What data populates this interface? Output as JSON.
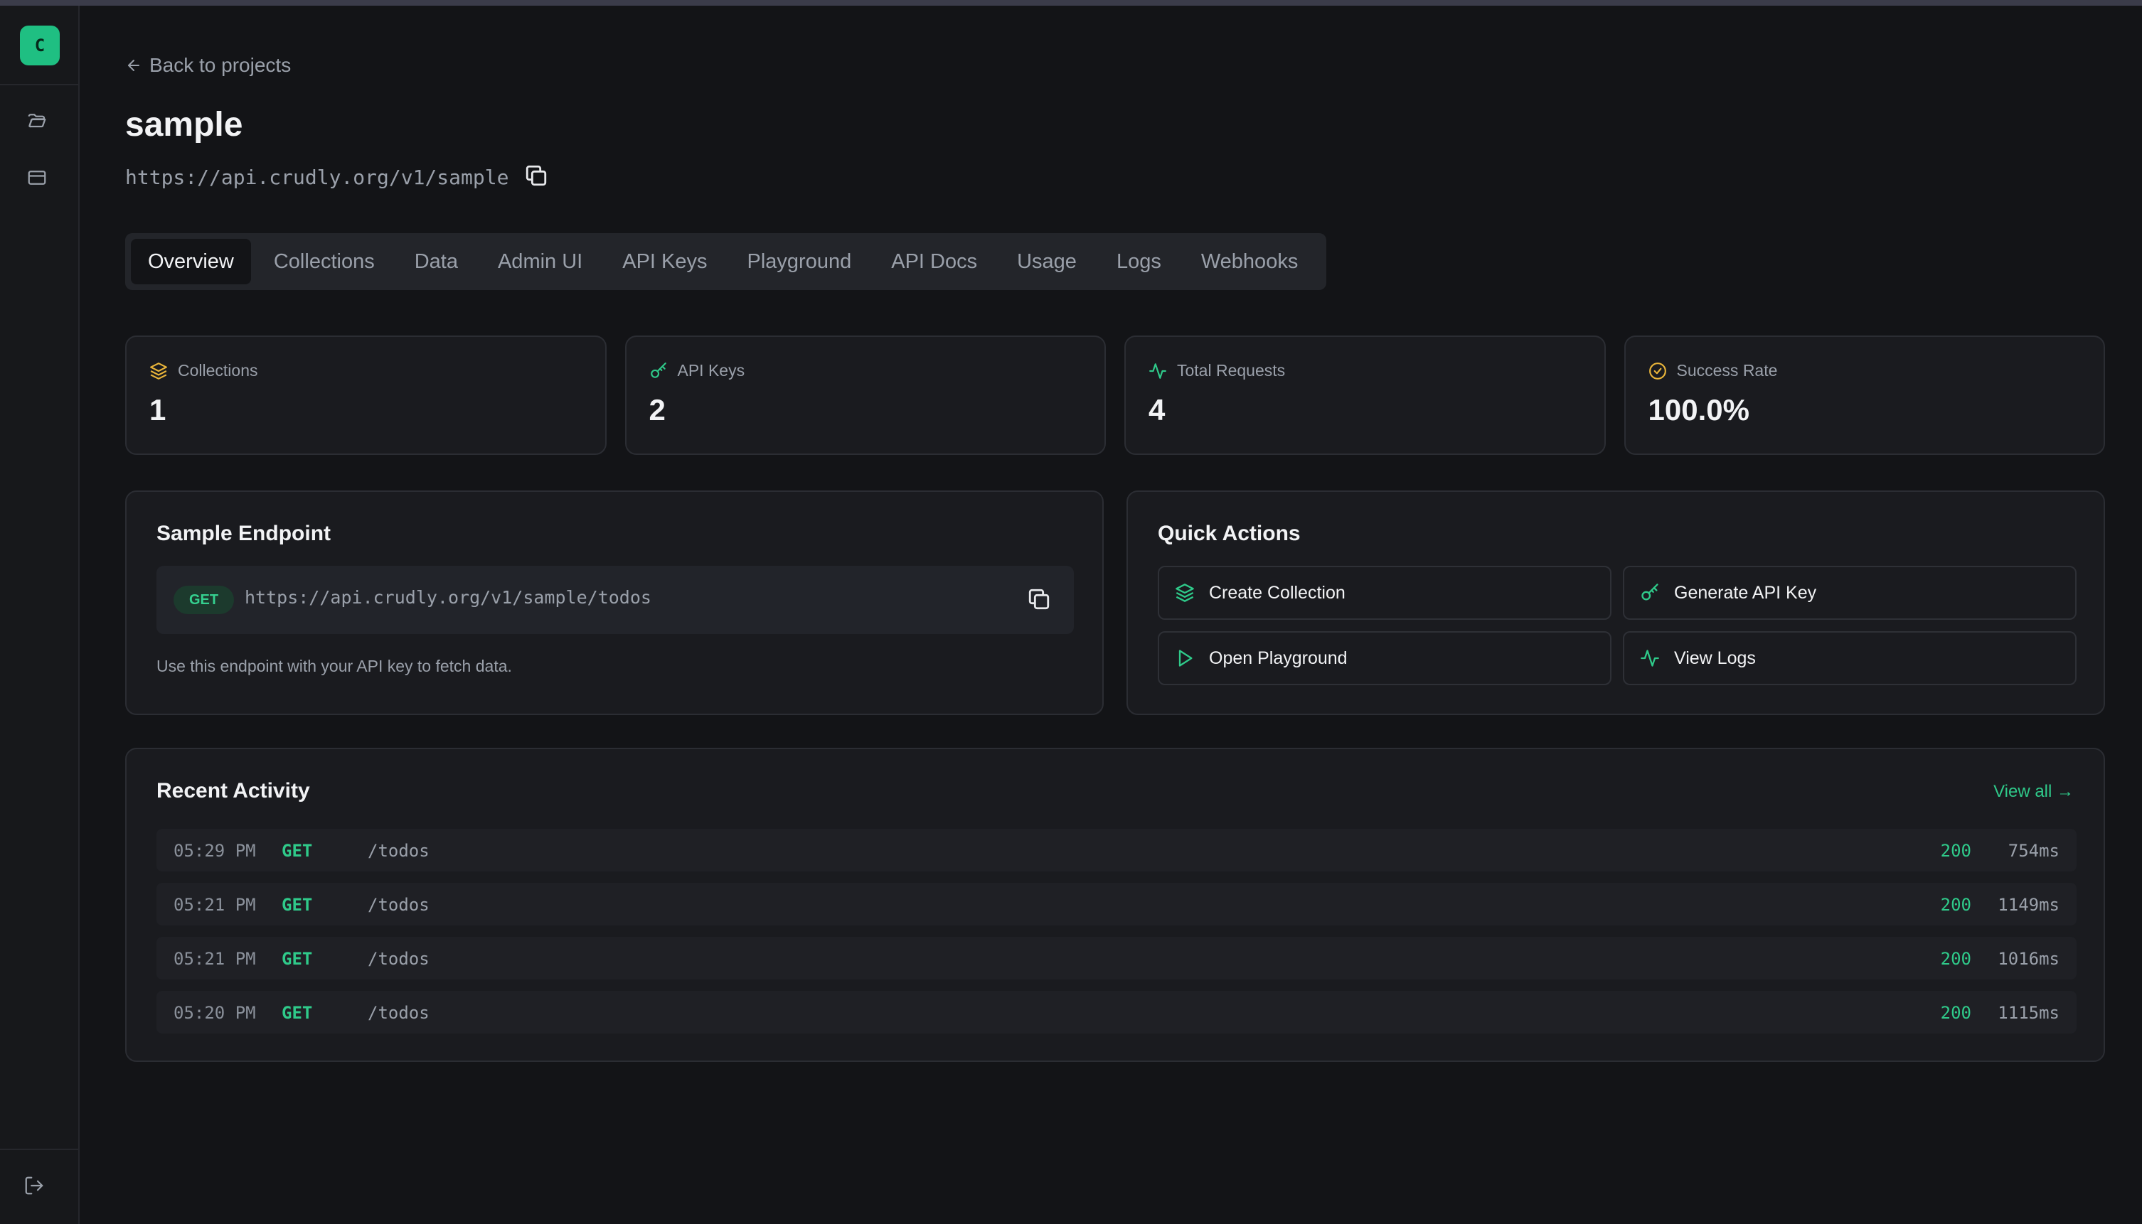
{
  "app": {
    "logo_letter": "C"
  },
  "header": {
    "back_label": "Back to projects",
    "project_name": "sample",
    "base_url": "https://api.crudly.org/v1/sample"
  },
  "tabs": [
    {
      "label": "Overview",
      "active": true
    },
    {
      "label": "Collections"
    },
    {
      "label": "Data"
    },
    {
      "label": "Admin UI"
    },
    {
      "label": "API Keys"
    },
    {
      "label": "Playground"
    },
    {
      "label": "API Docs"
    },
    {
      "label": "Usage"
    },
    {
      "label": "Logs"
    },
    {
      "label": "Webhooks"
    }
  ],
  "stats": [
    {
      "label": "Collections",
      "value": "1",
      "icon": "layers-icon"
    },
    {
      "label": "API Keys",
      "value": "2",
      "icon": "key-icon"
    },
    {
      "label": "Total Requests",
      "value": "4",
      "icon": "activity-icon"
    },
    {
      "label": "Success Rate",
      "value": "100.0%",
      "icon": "check-circle-icon"
    }
  ],
  "sample_endpoint": {
    "title": "Sample Endpoint",
    "method": "GET",
    "url": "https://api.crudly.org/v1/sample/todos",
    "note": "Use this endpoint with your API key to fetch data."
  },
  "quick_actions": {
    "title": "Quick Actions",
    "items": [
      {
        "label": "Create Collection",
        "icon": "layers-icon"
      },
      {
        "label": "Generate API Key",
        "icon": "key-icon"
      },
      {
        "label": "Open Playground",
        "icon": "play-icon"
      },
      {
        "label": "View Logs",
        "icon": "activity-icon"
      }
    ]
  },
  "recent_activity": {
    "title": "Recent Activity",
    "view_all": "View all →",
    "rows": [
      {
        "time": "05:29 PM",
        "method": "GET",
        "path": "/todos",
        "status": "200",
        "duration": "754ms"
      },
      {
        "time": "05:21 PM",
        "method": "GET",
        "path": "/todos",
        "status": "200",
        "duration": "1149ms"
      },
      {
        "time": "05:21 PM",
        "method": "GET",
        "path": "/todos",
        "status": "200",
        "duration": "1016ms"
      },
      {
        "time": "05:20 PM",
        "method": "GET",
        "path": "/todos",
        "status": "200",
        "duration": "1115ms"
      }
    ]
  },
  "colors": {
    "accent": "#2fca8a",
    "warning": "#e8b43a",
    "background": "#131417"
  }
}
